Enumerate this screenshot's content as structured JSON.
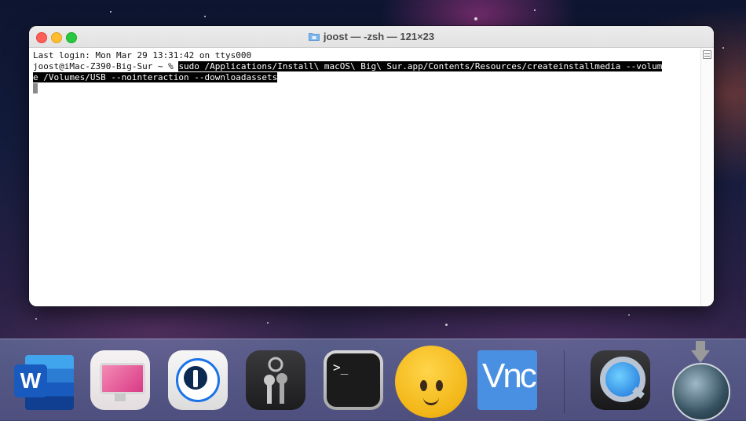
{
  "window": {
    "title": "joost — -zsh — 121×23",
    "title_icon": "folder-icon",
    "traffic_lights": {
      "close": "#fe5f57",
      "minimize": "#febc2e",
      "maximize": "#28c840"
    }
  },
  "terminal": {
    "last_login": "Last login: Mon Mar 29 13:31:42 on ttys000",
    "prompt": "joost@iMac-Z390-Big-Sur ~ % ",
    "command_line1": "sudo /Applications/Install\\ macOS\\ Big\\ Sur.app/Contents/Resources/createinstallmedia --volum",
    "command_line2": "e /Volumes/USB --nointeraction --downloadassets"
  },
  "dock": {
    "items": [
      {
        "name": "Microsoft Word",
        "icon": "word-icon",
        "letter": "W"
      },
      {
        "name": "CleanMyMac",
        "icon": "cleanmymac-icon"
      },
      {
        "name": "1Password",
        "icon": "1password-icon"
      },
      {
        "name": "Keychain Access",
        "icon": "keychain-icon"
      },
      {
        "name": "Terminal",
        "icon": "terminal-icon",
        "glyph": ">_"
      },
      {
        "name": "Emoji",
        "icon": "smiley-icon"
      },
      {
        "name": "VNC Viewer",
        "icon": "vnc-icon",
        "glyph": "Vnc"
      },
      {
        "name": "QuickTime Player",
        "icon": "quicktime-icon"
      },
      {
        "name": "Install macOS Big Sur",
        "icon": "install-macos-icon"
      }
    ]
  }
}
